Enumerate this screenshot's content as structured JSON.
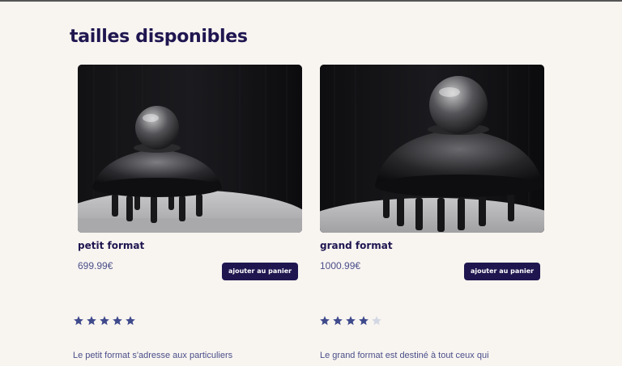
{
  "section": {
    "title": "tailles disponibles"
  },
  "products": [
    {
      "name": "petit format",
      "price": "699.99€",
      "button_label": "ajouter au panier",
      "rating": 5,
      "max_rating": 5,
      "description": "Le petit format s'adresse aux particuliers"
    },
    {
      "name": "grand format",
      "price": "1000.99€",
      "button_label": "ajouter au panier",
      "rating": 4,
      "max_rating": 5,
      "description": "Le grand format est destiné à tout ceux qui"
    }
  ],
  "colors": {
    "background": "#f8f4f0",
    "brand": "#1f1650",
    "star_filled": "#3f4a8c",
    "star_empty": "#d3d7e3",
    "text_muted": "#4a4f8a"
  },
  "icons": {
    "star": "star-icon",
    "product_image": "device-photo"
  }
}
